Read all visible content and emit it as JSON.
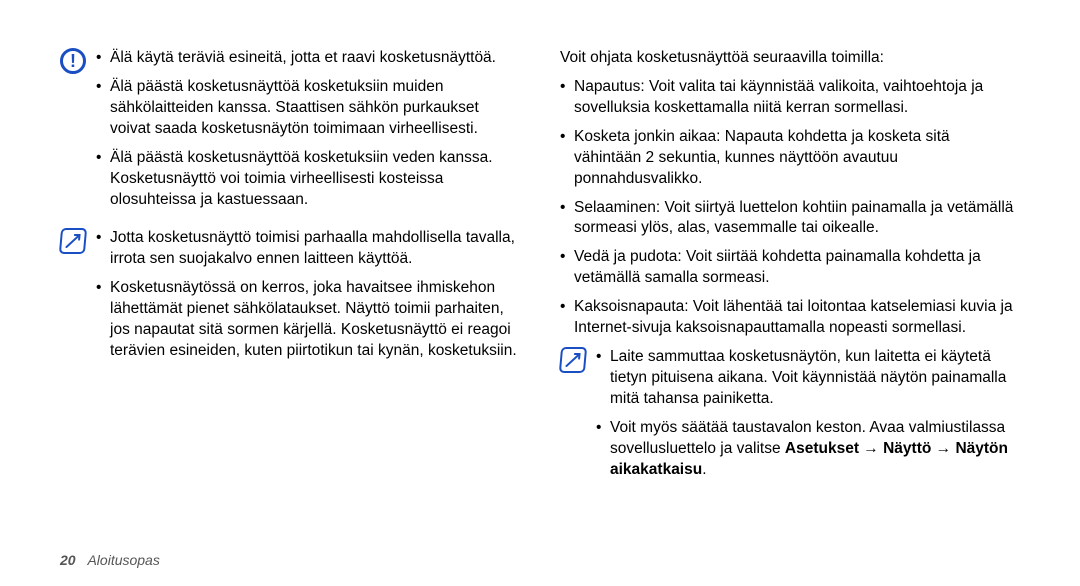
{
  "left": {
    "alert": {
      "items": [
        "Älä käytä teräviä esineitä, jotta et raavi kosketusnäyttöä.",
        "Älä päästä kosketusnäyttöä kosketuksiin muiden sähkölaitteiden kanssa. Staattisen sähkön purkaukset voivat saada kosketusnäytön toimimaan virheellisesti.",
        "Älä päästä kosketusnäyttöä kosketuksiin veden kanssa. Kosketusnäyttö voi toimia virheellisesti kosteissa olosuhteissa ja kastuessaan."
      ]
    },
    "note": {
      "items": [
        "Jotta kosketusnäyttö toimisi parhaalla mahdollisella tavalla, irrota sen suojakalvo ennen laitteen käyttöä.",
        "Kosketusnäytössä on kerros, joka havaitsee ihmiskehon lähettämät pienet sähkölataukset. Näyttö toimii parhaiten, jos napautat sitä sormen kärjellä. Kosketusnäyttö ei reagoi terävien esineiden, kuten piirtotikun tai kynän, kosketuksiin."
      ]
    }
  },
  "right": {
    "lead": "Voit ohjata kosketusnäyttöä seuraavilla toimilla:",
    "items": [
      "Napautus: Voit valita tai käynnistää valikoita, vaihtoehtoja ja sovelluksia koskettamalla niitä kerran sormellasi.",
      "Kosketa jonkin aikaa: Napauta kohdetta ja kosketa sitä vähintään 2 sekuntia, kunnes näyttöön avautuu ponnahdusvalikko.",
      "Selaaminen: Voit siirtyä luettelon kohtiin painamalla ja vetämällä sormeasi ylös, alas, vasemmalle tai oikealle.",
      "Vedä ja pudota: Voit siirtää kohdetta painamalla kohdetta ja vetämällä samalla sormeasi.",
      "Kaksoisnapauta: Voit lähentää tai loitontaa katselemiasi kuvia ja Internet-sivuja kaksoisnapauttamalla nopeasti sormellasi."
    ],
    "note": {
      "item1": "Laite sammuttaa kosketusnäytön, kun laitetta ei käytetä tietyn pituisena aikana. Voit käynnistää näytön painamalla mitä tahansa painiketta.",
      "item2_a": "Voit myös säätää taustavalon keston. Avaa valmiustilassa sovellusluettelo ja valitse ",
      "item2_b": "Asetukset → Näyttö → Näytön aikakatkaisu",
      "item2_c": "."
    }
  },
  "footer": {
    "page": "20",
    "section": "Aloitusopas"
  }
}
